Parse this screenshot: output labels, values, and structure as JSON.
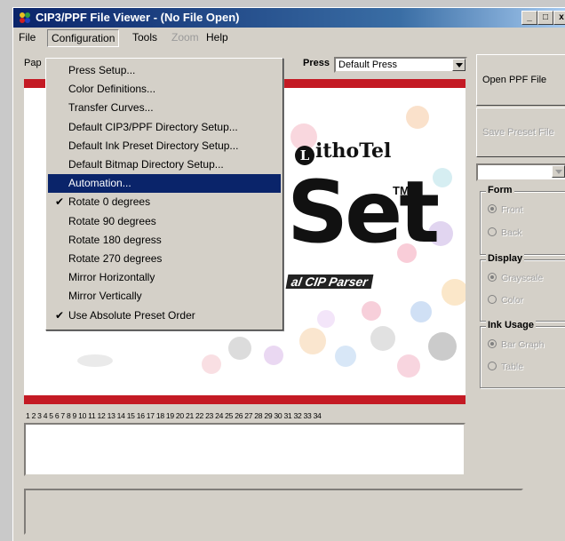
{
  "window": {
    "title": "CIP3/PPF File Viewer - (No File Open)"
  },
  "title_buttons": {
    "minimize": "_",
    "maximize": "□",
    "close": "x"
  },
  "menubar": {
    "file": "File",
    "configuration": "Configuration",
    "tools": "Tools",
    "zoom": "Zoom",
    "help": "Help"
  },
  "toolbar": {
    "paper_label": "Pap",
    "press_label": "Press",
    "press_value": "Default Press"
  },
  "configuration_menu": [
    {
      "label": "Press Setup...",
      "checked": false
    },
    {
      "label": "Color Definitions...",
      "checked": false
    },
    {
      "label": "Transfer Curves...",
      "checked": false
    },
    {
      "label": "Default CIP3/PPF Directory Setup...",
      "checked": false
    },
    {
      "label": "Default Ink Preset Directory Setup...",
      "checked": false
    },
    {
      "label": "Default Bitmap Directory Setup...",
      "checked": false
    },
    {
      "label": "Automation...",
      "checked": false,
      "highlighted": true
    },
    {
      "label": "Rotate 0 degrees",
      "checked": true
    },
    {
      "label": "Rotate 90 degrees",
      "checked": false
    },
    {
      "label": "Rotate 180 degress",
      "checked": false
    },
    {
      "label": "Rotate 270 degrees",
      "checked": false
    },
    {
      "label": "Mirror Horizontally",
      "checked": false
    },
    {
      "label": "Mirror Vertically",
      "checked": false
    },
    {
      "label": "Use Absolute Preset Order",
      "checked": true
    }
  ],
  "check_glyph": "✔",
  "splash": {
    "brand": "ithoTel",
    "brand_initial": "L",
    "big_word": "Set",
    "tm": "TM",
    "tagline": "al CIP Parser"
  },
  "zone_numbers": "1 2 3 4 5 6 7 8 9 10 11 12 13 14 15 16 17 18 19 20 21 22 23 24 25 26 27 28 29 30 31 32 33 34",
  "right_panel": {
    "open_button": "Open PPF File",
    "save_button": "Save Preset File",
    "form": {
      "legend": "Form",
      "options": [
        "Front",
        "Back"
      ],
      "selected": 0
    },
    "display": {
      "legend": "Display",
      "options": [
        "Grayscale",
        "Color"
      ],
      "selected": 0
    },
    "ink_usage": {
      "legend": "Ink Usage",
      "options": [
        "Bar Graph",
        "Table"
      ],
      "selected": 0
    }
  },
  "colors": {
    "accent_red": "#c41a24",
    "title_blue": "#0a246a",
    "menu_highlight": "#0a246a"
  }
}
